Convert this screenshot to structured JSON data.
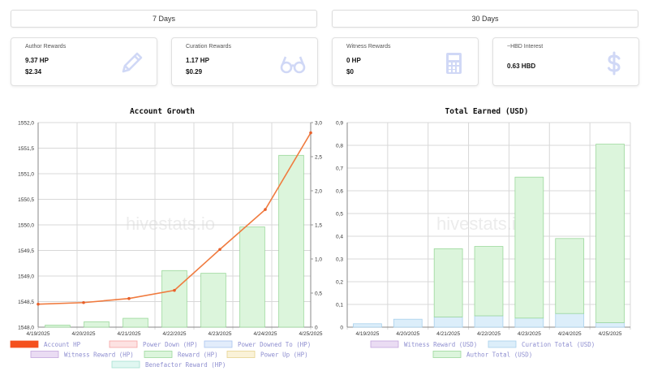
{
  "tabs": [
    {
      "label": "7 Days"
    },
    {
      "label": "30 Days"
    }
  ],
  "cards": [
    {
      "title": "Author Rewards",
      "value1": "9.37 HP",
      "value2": "$2.34",
      "icon": "pencil-icon"
    },
    {
      "title": "Curation Rewards",
      "value1": "1.17 HP",
      "value2": "$0.29",
      "icon": "glasses-icon"
    },
    {
      "title": "Witness Rewards",
      "value1": "0 HP",
      "value2": "$0",
      "icon": "calculator-icon"
    },
    {
      "title": "~HBD Interest",
      "value1": "0.63 HBD",
      "value2": "",
      "icon": "dollar-icon"
    }
  ],
  "colors": {
    "account_hp": "#f4511e",
    "line": "#f07b3f",
    "reward_fill": "#dcf5dc",
    "reward_stroke": "#9bd89b",
    "curation_fill": "#dceefa",
    "curation_stroke": "#a8d0ec",
    "icon": "#d0d8f6"
  },
  "watermark": "hivestats.io",
  "chart_data": [
    {
      "type": "bar",
      "title": "Account Growth",
      "categories": [
        "4/19/2025",
        "4/20/2025",
        "4/21/2025",
        "4/22/2025",
        "4/23/2025",
        "4/24/2025",
        "4/25/2025"
      ],
      "y_left": {
        "range": [
          1548.0,
          1552.0
        ],
        "ticks": [
          "1548,0",
          "1548,5",
          "1549,0",
          "1549,5",
          "1550,0",
          "1550,5",
          "1551,0",
          "1551,5",
          "1552,0"
        ]
      },
      "y_right": {
        "range": [
          0,
          3.0
        ],
        "ticks": [
          "0",
          "0,5",
          "1,0",
          "1,5",
          "2,0",
          "2,5",
          "3,0"
        ]
      },
      "series": [
        {
          "name": "Account HP",
          "kind": "line",
          "axis": "left",
          "values": [
            1548.45,
            1548.48,
            1548.56,
            1548.72,
            1549.52,
            1550.3,
            1551.8
          ]
        },
        {
          "name": "Reward (HP)",
          "kind": "bar",
          "axis": "right",
          "values": [
            0.03,
            0.08,
            0.13,
            0.83,
            0.79,
            1.47,
            2.52
          ]
        }
      ],
      "legend": [
        {
          "name": "Account HP",
          "fill": "#f4511e",
          "stroke": "#f4511e"
        },
        {
          "name": "Power Down (HP)",
          "fill": "#fde2e2",
          "stroke": "#f5a3a3"
        },
        {
          "name": "Power Downed To (HP)",
          "fill": "#e2ecfb",
          "stroke": "#a9c3ef"
        },
        {
          "name": "Witness Reward (HP)",
          "fill": "#eadcf3",
          "stroke": "#c4a6dc"
        },
        {
          "name": "Reward (HP)",
          "fill": "#dcf5dc",
          "stroke": "#9bd89b"
        },
        {
          "name": "Power Up (HP)",
          "fill": "#faf2d8",
          "stroke": "#e6d28f"
        },
        {
          "name": "Benefactor Reward (HP)",
          "fill": "#e0f7f1",
          "stroke": "#a6e0d0"
        }
      ]
    },
    {
      "type": "bar",
      "title": "Total Earned (USD)",
      "categories": [
        "4/19/2025",
        "4/20/2025",
        "4/21/2025",
        "4/22/2025",
        "4/23/2025",
        "4/24/2025",
        "4/25/2025"
      ],
      "y": {
        "range": [
          0,
          0.9
        ],
        "ticks": [
          "0",
          "0,1",
          "0,2",
          "0,3",
          "0,4",
          "0,5",
          "0,6",
          "0,7",
          "0,8",
          "0,9"
        ]
      },
      "stacked": true,
      "series": [
        {
          "name": "Witness Reward (USD)",
          "values": [
            0,
            0,
            0,
            0,
            0,
            0,
            0
          ]
        },
        {
          "name": "Curation Total (USD)",
          "values": [
            0.015,
            0.035,
            0.045,
            0.05,
            0.04,
            0.06,
            0.02
          ]
        },
        {
          "name": "Author Total (USD)",
          "values": [
            0,
            0,
            0.3,
            0.305,
            0.62,
            0.33,
            0.785
          ]
        }
      ],
      "legend": [
        {
          "name": "Witness Reward (USD)",
          "fill": "#eadcf3",
          "stroke": "#c4a6dc"
        },
        {
          "name": "Curation Total (USD)",
          "fill": "#dceefa",
          "stroke": "#a8d0ec"
        },
        {
          "name": "Author Total (USD)",
          "fill": "#dcf5dc",
          "stroke": "#9bd89b"
        }
      ]
    }
  ]
}
